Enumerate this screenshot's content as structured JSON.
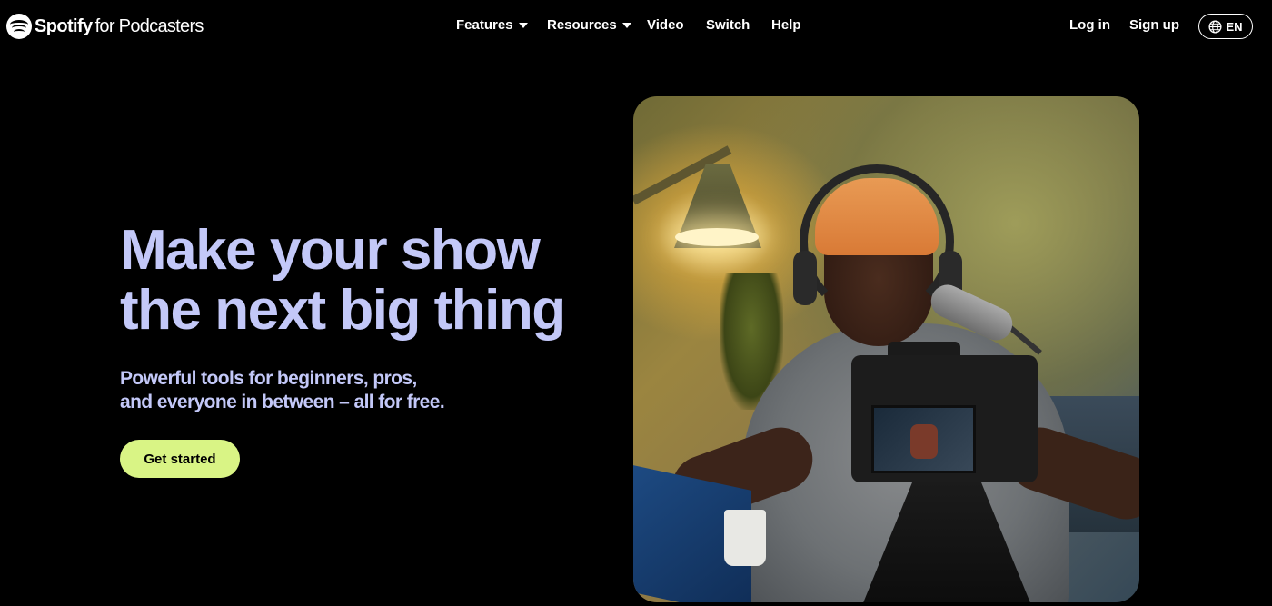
{
  "brand": {
    "name": "Spotify",
    "sub": "for Podcasters"
  },
  "nav": {
    "features": "Features",
    "resources": "Resources",
    "video": "Video",
    "switch": "Switch",
    "help": "Help"
  },
  "account": {
    "login": "Log in",
    "signup": "Sign up",
    "language": "EN"
  },
  "hero": {
    "title_line1": "Make your show",
    "title_line2": "the next big thing",
    "subtitle_line1": "Powerful tools for beginners, pros,",
    "subtitle_line2": "and everyone in between – all for free.",
    "cta": "Get started"
  },
  "colors": {
    "background": "#000000",
    "headline": "#c3c8f8",
    "cta_background": "#d9f485",
    "cta_text": "#000000"
  }
}
